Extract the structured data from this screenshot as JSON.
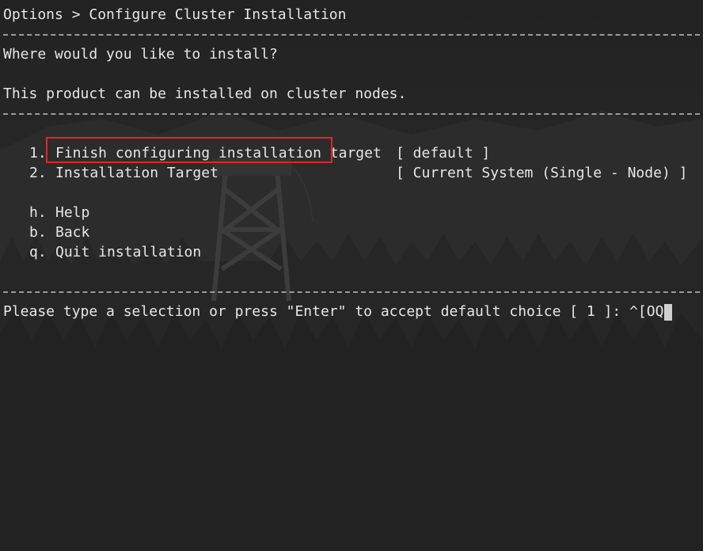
{
  "breadcrumb": "Options > Configure Cluster Installation",
  "question": "Where would you like to install?",
  "description": "This product can be installed on cluster nodes.",
  "menu": [
    {
      "key": "1.",
      "label": "Finish configuring installation target",
      "value": "[ default ]"
    },
    {
      "key": "2.",
      "label": "Installation Target",
      "value": "[ Current System (Single - Node) ]"
    }
  ],
  "commands": [
    {
      "key": "h.",
      "label": "Help"
    },
    {
      "key": "b.",
      "label": "Back"
    },
    {
      "key": "q.",
      "label": "Quit installation"
    }
  ],
  "prompt": "Please type a selection or press \"Enter\" to accept default choice [ 1 ]: ^[OQ"
}
